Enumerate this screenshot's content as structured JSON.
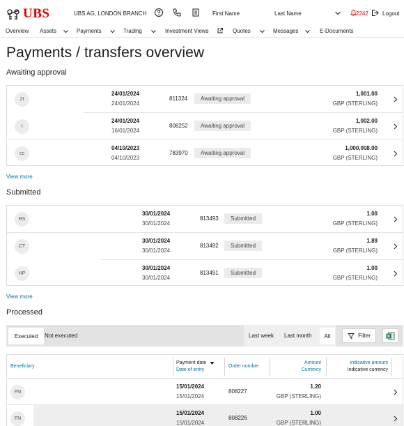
{
  "brand": {
    "name": "UBS",
    "color": "#e60000"
  },
  "header": {
    "branch": "UBS AG, LONDON BRANCH",
    "first_name": "First Name",
    "last_name": "Last Name",
    "notification_count": "2242",
    "logout": "Logout",
    "icons": [
      "help-icon",
      "phone-icon",
      "document-icon",
      "chevron-down-icon",
      "bell-icon",
      "logout-icon"
    ]
  },
  "nav": {
    "items": [
      {
        "label": "Overview"
      },
      {
        "label": "Assets"
      },
      {
        "label": "Payments"
      },
      {
        "label": "Trading"
      },
      {
        "label": "Investment Views"
      },
      {
        "label": "Quotes"
      },
      {
        "label": "Messages"
      },
      {
        "label": "E-Documents"
      }
    ]
  },
  "page": {
    "title": "Payments / transfers overview"
  },
  "awaiting": {
    "title": "Awaiting approval",
    "view_more": "View more",
    "rows": [
      {
        "initials": "2t",
        "date_main": "24/01/2024",
        "date_sub": "24/01/2024",
        "order": "811324",
        "status": "Awaiting approval",
        "amount": "1,001.00",
        "currency": "GBP (STERLING)"
      },
      {
        "initials": "t",
        "date_main": "24/01/2024",
        "date_sub": "16/01/2024",
        "order": "808252",
        "status": "Awaiting approval",
        "amount": "1,002.00",
        "currency": "GBP (STERLING)"
      },
      {
        "initials": "cc",
        "date_main": "04/10/2023",
        "date_sub": "04/10/2023",
        "order": "783970",
        "status": "Awaiting approval",
        "amount": "1,000,008.00",
        "currency": "GBP (STERLING)"
      }
    ]
  },
  "submitted": {
    "title": "Submitted",
    "view_more": "View more",
    "rows": [
      {
        "initials": "RS",
        "date_main": "30/01/2024",
        "date_sub": "30/01/2024",
        "order": "813493",
        "status": "Submitted",
        "amount": "1.00",
        "currency": "GBP (STERLING)"
      },
      {
        "initials": "CT",
        "date_main": "30/01/2024",
        "date_sub": "30/01/2024",
        "order": "813492",
        "status": "Submitted",
        "amount": "1.89",
        "currency": "GBP (STERLING)"
      },
      {
        "initials": "HP",
        "date_main": "30/01/2024",
        "date_sub": "30/01/2024",
        "order": "813491",
        "status": "Submitted",
        "amount": "1.00",
        "currency": "GBP (STERLING)"
      }
    ]
  },
  "processed": {
    "title": "Processed",
    "tabs": {
      "executed": "Executed",
      "not_executed": "Not executed"
    },
    "periods": {
      "last_week": "Last week",
      "last_month": "Last month",
      "all": "All"
    },
    "filter": "Filter",
    "excel_icon": "excel-icon",
    "columns": {
      "beneficiary": "Beneficiary",
      "payment_date": "Payment date",
      "date_of_entry": "Date of entry",
      "order_number": "Order number",
      "amount": "Amount",
      "currency": "Currency",
      "indicative_amount": "Indicative amount",
      "indicative_currency": "Indicative currency"
    },
    "rows": [
      {
        "initials": "FN",
        "date_main": "15/01/2024",
        "date_sub": "15/01/2024",
        "order": "808227",
        "amount": "1.20",
        "currency": "GBP (STERLING)"
      },
      {
        "initials": "FN",
        "date_main": "15/01/2024",
        "date_sub": "15/01/2024",
        "order": "808226",
        "amount": "1.00",
        "currency": "GBP (STERLING)"
      }
    ]
  }
}
